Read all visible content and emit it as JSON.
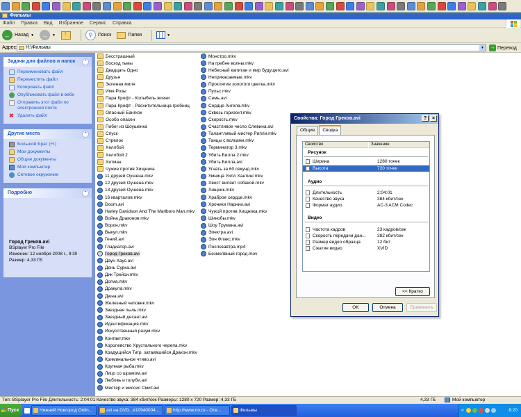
{
  "window": {
    "title": "Фильмы"
  },
  "menu": [
    "Файл",
    "Правка",
    "Вид",
    "Избранное",
    "Сервис",
    "Справка"
  ],
  "toolbar": {
    "back": "Назад",
    "search": "Поиск",
    "folders": "Папки"
  },
  "address": {
    "label": "Адрес:",
    "path": "H:\\Фильмы",
    "go": "Переход"
  },
  "tasks_panel": {
    "title": "Задачи для файлов и папок",
    "items": [
      "Переименовать файл",
      "Переместить файл",
      "Копировать файл",
      "Опубликовать файл в вебе",
      "Отправить этот файл по электронной почте",
      "Удалить файл"
    ]
  },
  "places_panel": {
    "title": "Другие места",
    "items": [
      "Большой Брат (H:)",
      "Мои документы",
      "Общие документы",
      "Мой компьютер",
      "Сетевое окружение"
    ]
  },
  "details_panel": {
    "title": "Подробно",
    "name": "Город Греков.avi",
    "type": "BSplayer Pro File",
    "modified": "Изменен: 12 ноября 2008 г., 9:30",
    "size": "Размер: 4,33 ГБ"
  },
  "files": {
    "col1": [
      {
        "name": "Бесстрашный",
        "kind": "folder"
      },
      {
        "name": "Восход тьмы",
        "kind": "folder"
      },
      {
        "name": "Двадцать Одно",
        "kind": "folder"
      },
      {
        "name": "Друзья",
        "kind": "folder"
      },
      {
        "name": "Зеленая миля",
        "kind": "folder"
      },
      {
        "name": "Имя Розы",
        "kind": "folder"
      },
      {
        "name": "Пара Крофт - Колыбель жизни",
        "kind": "folder"
      },
      {
        "name": "Пара Крофт - Расхитительница гробниц",
        "kind": "folder"
      },
      {
        "name": "Опасный Бангкок",
        "kind": "folder"
      },
      {
        "name": "Особо опасен",
        "kind": "folder"
      },
      {
        "name": "Побег из Шоушенка",
        "kind": "folder"
      },
      {
        "name": "Спуск",
        "kind": "folder"
      },
      {
        "name": "Стрелок",
        "kind": "folder"
      },
      {
        "name": "Хеллбой",
        "kind": "folder"
      },
      {
        "name": "Хеллбой 2",
        "kind": "folder"
      },
      {
        "name": "Хитман",
        "kind": "folder"
      },
      {
        "name": "Чужие против Хищника",
        "kind": "folder"
      },
      {
        "name": "11 друзей Оушена.mkv",
        "kind": "media"
      },
      {
        "name": "12 друзей Оушена.mkv",
        "kind": "media"
      },
      {
        "name": "13 друзей Оушена.mkv",
        "kind": "media"
      },
      {
        "name": "16 кварталов.mkv",
        "kind": "media"
      },
      {
        "name": "Doom.avi",
        "kind": "media"
      },
      {
        "name": "Harley Davidson And The Marlboro Man.mkv",
        "kind": "media"
      },
      {
        "name": "Война Драконов.mkv",
        "kind": "media"
      },
      {
        "name": "Ворон.mkv",
        "kind": "media"
      },
      {
        "name": "Выкуп.mkv",
        "kind": "media"
      },
      {
        "name": "Гений.avi",
        "kind": "media"
      },
      {
        "name": "Гладиатор.avi",
        "kind": "media"
      },
      {
        "name": "Город Греков.avi",
        "kind": "media",
        "selected": true
      },
      {
        "name": "Даун Хаус.avi",
        "kind": "media"
      },
      {
        "name": "День Сурка.avi",
        "kind": "media"
      },
      {
        "name": "Дик Трейси.mkv",
        "kind": "media"
      },
      {
        "name": "Догма.mkv",
        "kind": "media"
      },
      {
        "name": "Дракула.mkv",
        "kind": "media"
      },
      {
        "name": "Дюна.avi",
        "kind": "media"
      },
      {
        "name": "Железный человек.mkv",
        "kind": "media"
      },
      {
        "name": "Звездная пыль.mkv",
        "kind": "media"
      },
      {
        "name": "Звездный десант.avi",
        "kind": "media"
      },
      {
        "name": "Идентификация.mkv",
        "kind": "media"
      },
      {
        "name": "Искусственный разум.mkv",
        "kind": "media"
      },
      {
        "name": "Контакт.mkv",
        "kind": "media"
      },
      {
        "name": "Королевство Хрустального черепа.mkv",
        "kind": "media"
      },
      {
        "name": "Крадущийся Тигр, затаившийся Дракон.mkv",
        "kind": "media"
      },
      {
        "name": "Криминальное чтиво.avi",
        "kind": "media"
      },
      {
        "name": "Крупная рыба.mkv",
        "kind": "media"
      },
      {
        "name": "Лицо со шрамом.avi",
        "kind": "media"
      },
      {
        "name": "Любовь и голуби.avi",
        "kind": "media"
      },
      {
        "name": "Мистер и миссис Смит.avi",
        "kind": "media"
      }
    ],
    "col2": [
      {
        "name": "Монстро.mkv",
        "kind": "media"
      },
      {
        "name": "На гребне волны.mkv",
        "kind": "media"
      },
      {
        "name": "Небесный капитан и мир будущего.avi",
        "kind": "media"
      },
      {
        "name": "Неприкасаемые.mkv",
        "kind": "media"
      },
      {
        "name": "Проклятие золотого цветка.mkv",
        "kind": "media"
      },
      {
        "name": "Пульс.mkv",
        "kind": "media"
      },
      {
        "name": "Семь.avi",
        "kind": "media"
      },
      {
        "name": "Сердце Ангела.mkv",
        "kind": "media"
      },
      {
        "name": "Сквозь горизонт.mkv",
        "kind": "media"
      },
      {
        "name": "Скорость.mkv",
        "kind": "media"
      },
      {
        "name": "Счастливое число Слевина.avi",
        "kind": "media"
      },
      {
        "name": "Талантливый мистер Рипли.mkv",
        "kind": "media"
      },
      {
        "name": "Танцы с волками.mkv",
        "kind": "media"
      },
      {
        "name": "Терминатор 3.mkv",
        "kind": "media"
      },
      {
        "name": "Убить Билла 2.mkv",
        "kind": "media"
      },
      {
        "name": "Убить Билла.avi",
        "kind": "media"
      },
      {
        "name": "Угнать за 60 секунд.mkv",
        "kind": "media"
      },
      {
        "name": "Умница Уилл Хантинг.mkv",
        "kind": "media"
      },
      {
        "name": "Хвост виляет собакой.mkv",
        "kind": "media"
      },
      {
        "name": "Хищник.mkv",
        "kind": "media"
      },
      {
        "name": "Храброе сердце.mkv",
        "kind": "media"
      },
      {
        "name": "Хроники Нарнии.avi",
        "kind": "media"
      },
      {
        "name": "Чужой против Хищника.mkv",
        "kind": "media"
      },
      {
        "name": "Шинобы.mkv",
        "kind": "media"
      },
      {
        "name": "Шоу Трумана.avi",
        "kind": "media"
      },
      {
        "name": "Электра.avi",
        "kind": "media"
      },
      {
        "name": "Эон Флакс.mkv",
        "kind": "media"
      },
      {
        "name": "Послезавтра.mp4",
        "kind": "media"
      },
      {
        "name": "Безмолвный город.mov",
        "kind": "media"
      }
    ]
  },
  "dialog": {
    "title": "Свойства: Город Греков.avi",
    "tabs": [
      "Общие",
      "Сводка"
    ],
    "headers": [
      "Свойство",
      "Значение"
    ],
    "groups": [
      {
        "title": "Рисунок",
        "rows": [
          {
            "key": "Ширина",
            "value": "1280 точек"
          },
          {
            "key": "Высота",
            "value": "720 точек",
            "selected": true
          }
        ]
      },
      {
        "title": "Аудио",
        "rows": [
          {
            "key": "Длительность",
            "value": "2:04:01"
          },
          {
            "key": "Качество звука",
            "value": "384 кбит/сек"
          },
          {
            "key": "Формат аудио",
            "value": "AC-3 ACM Codec"
          }
        ]
      },
      {
        "title": "Видео",
        "rows": [
          {
            "key": "Частота кадров",
            "value": "23 кадров/сек"
          },
          {
            "key": "Скорость передачи дан...",
            "value": "382 кбит/сек"
          },
          {
            "key": "Размер видео образца",
            "value": "12 бит"
          },
          {
            "key": "Сжатие видео",
            "value": "XVID"
          }
        ]
      }
    ],
    "brief": "<< Кратко",
    "ok": "OK",
    "cancel": "Отмена",
    "apply": "Применить"
  },
  "status": {
    "text": "Тип: BSplayer Pro File Длительность: 2:04:01 Качество звука: 384 кбит/сек Размеры: 1280 x 720 Размер: 4,33 ГБ",
    "size": "4,33 ГБ",
    "location": "Мой компьютер"
  },
  "taskbar": {
    "start": "Пуск",
    "tasks": [
      {
        "label": "Нижний Новгород Onlin..."
      },
      {
        "label": "avi на DVD...#10940004..."
      },
      {
        "label": "http://www.nn.ru - Отв..."
      },
      {
        "label": "Фильмы",
        "active": true
      }
    ],
    "clock": "8:20"
  },
  "colors": {
    "accent": "#316ac5",
    "taskbar": "#245edb",
    "taskpane": "#7a96df"
  }
}
